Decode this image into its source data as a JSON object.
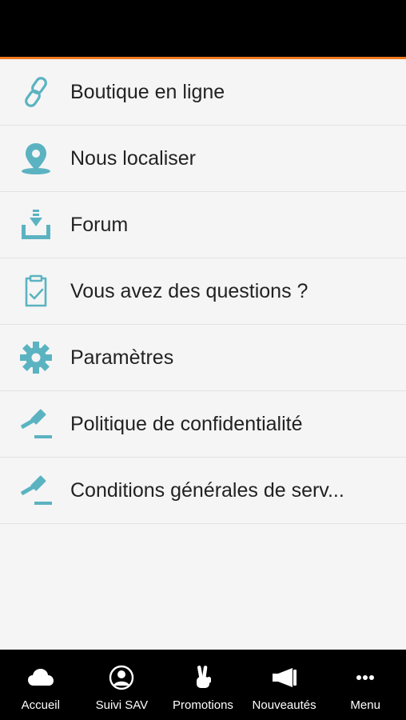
{
  "colors": {
    "accent": "#5bb3c1",
    "header": "#000000",
    "orange_line": "#f07c22",
    "nav_bg": "#000000"
  },
  "menu": {
    "items": [
      {
        "label": "Boutique en ligne",
        "icon": "link-icon"
      },
      {
        "label": "Nous localiser",
        "icon": "location-pin-icon"
      },
      {
        "label": "Forum",
        "icon": "download-tray-icon"
      },
      {
        "label": "Vous avez des questions ?",
        "icon": "clipboard-check-icon"
      },
      {
        "label": "Paramètres",
        "icon": "gear-icon"
      },
      {
        "label": "Politique de confidentialité",
        "icon": "gavel-icon"
      },
      {
        "label": "Conditions générales de serv...",
        "icon": "gavel-icon"
      }
    ]
  },
  "nav": {
    "items": [
      {
        "label": "Accueil",
        "icon": "cloud-icon"
      },
      {
        "label": "Suivi SAV",
        "icon": "user-circle-icon"
      },
      {
        "label": "Promotions",
        "icon": "peace-hand-icon"
      },
      {
        "label": "Nouveautés",
        "icon": "megaphone-icon"
      },
      {
        "label": "Menu",
        "icon": "more-dots-icon"
      }
    ]
  }
}
